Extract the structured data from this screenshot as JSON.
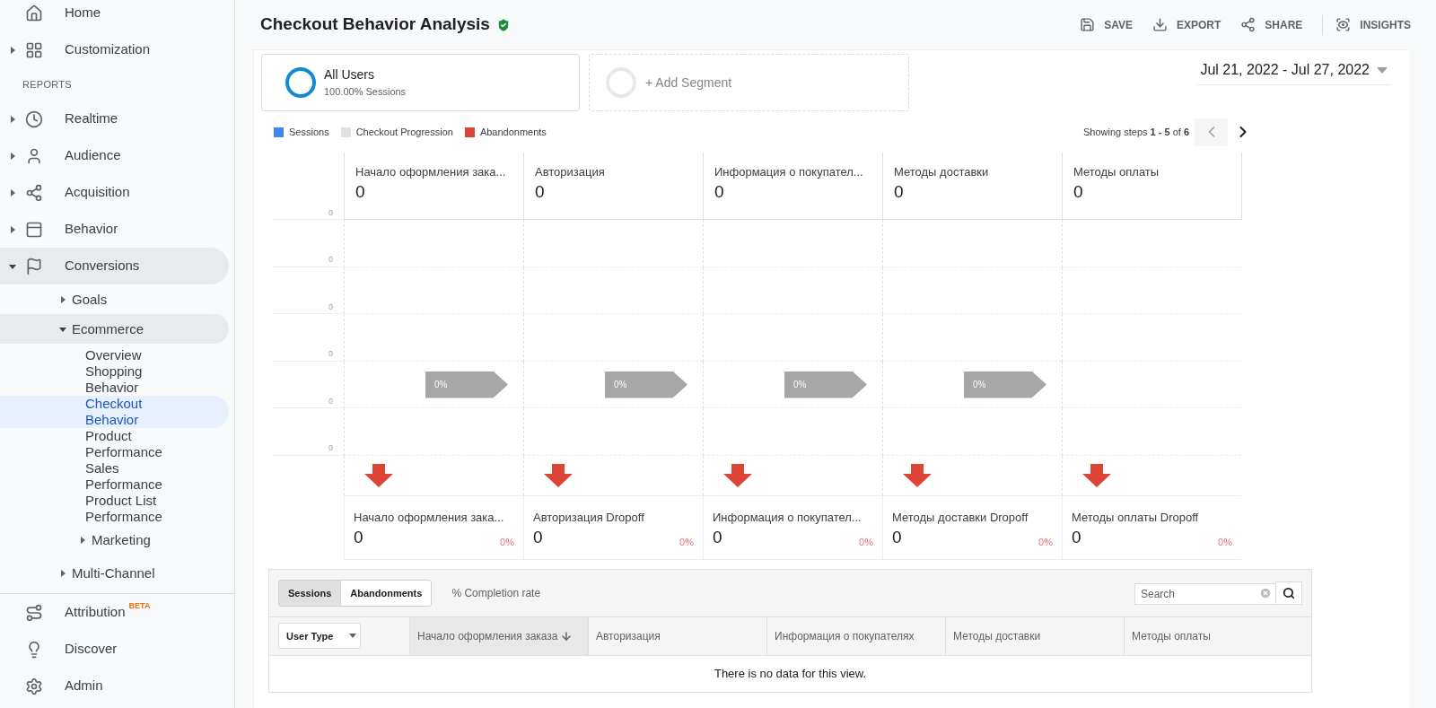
{
  "sidebar": {
    "top": [
      {
        "label": "Home",
        "selected": false
      },
      {
        "label": "Customization",
        "expanded": false,
        "selected": false
      }
    ],
    "reports_heading": "REPORTS",
    "reports": [
      {
        "label": "Realtime",
        "expanded": false,
        "selected": false
      },
      {
        "label": "Audience",
        "expanded": false,
        "selected": false
      },
      {
        "label": "Acquisition",
        "expanded": false,
        "selected": false
      },
      {
        "label": "Behavior",
        "expanded": false,
        "selected": false
      },
      {
        "label": "Conversions",
        "expanded": true,
        "selected": false,
        "children": [
          {
            "label": "Goals",
            "expanded": false,
            "selected": false
          },
          {
            "label": "Ecommerce",
            "expanded": true,
            "selected": false,
            "children": [
              {
                "label": "Overview",
                "selected": false
              },
              {
                "label": "Shopping Behavior",
                "selected": false
              },
              {
                "label": "Checkout Behavior",
                "selected": true
              },
              {
                "label": "Product Performance",
                "selected": false
              },
              {
                "label": "Sales Performance",
                "selected": false
              },
              {
                "label": "Product List Performance",
                "selected": false
              },
              {
                "label": "Marketing",
                "expanded": false,
                "selected": false
              }
            ]
          },
          {
            "label": "Multi-Channel",
            "expanded": false,
            "selected": false
          }
        ]
      }
    ],
    "bottom": [
      {
        "label": "Attribution",
        "badge": "BETA",
        "selected": false
      },
      {
        "label": "Discover",
        "selected": false
      },
      {
        "label": "Admin",
        "selected": false
      }
    ]
  },
  "header": {
    "title": "Checkout Behavior Analysis",
    "verified": true,
    "actions": [
      "SAVE",
      "EXPORT",
      "SHARE",
      "INSIGHTS"
    ]
  },
  "segments": [
    {
      "name": "All Users",
      "detail": "100.00% Sessions",
      "kind": "active"
    },
    {
      "name": "+ Add Segment",
      "kind": "add"
    }
  ],
  "date_range": "Jul 21, 2022 - Jul 27, 2022",
  "legend": [
    {
      "label": "Sessions",
      "color": "#4285f4"
    },
    {
      "label": "Checkout Progression",
      "color": "#e0e0e0"
    },
    {
      "label": "Abandonments",
      "color": "#db4437"
    }
  ],
  "pagination": {
    "text": "Showing steps **1 - 5** of **6**",
    "prev_disabled": true,
    "next_disabled": false
  },
  "funnel": {
    "axis_labels": [
      "0",
      "0",
      "0",
      "0",
      "0",
      "0"
    ],
    "steps": [
      {
        "label": "Начало оформления зака...",
        "value": "0",
        "progression": "0%",
        "dropoff_label": "Начало оформления зака...",
        "dropoff_value": "0",
        "dropoff_rate": "0%"
      },
      {
        "label": "Авторизация",
        "value": "0",
        "progression": "0%",
        "dropoff_label": "Авторизация Dropoff",
        "dropoff_value": "0",
        "dropoff_rate": "0%"
      },
      {
        "label": "Информация о покупател...",
        "value": "0",
        "progression": "0%",
        "dropoff_label": "Информация о покупател...",
        "dropoff_value": "0",
        "dropoff_rate": "0%"
      },
      {
        "label": "Методы доставки",
        "value": "0",
        "progression": "0%",
        "dropoff_label": "Методы доставки Dropoff",
        "dropoff_value": "0",
        "dropoff_rate": "0%"
      },
      {
        "label": "Методы оплаты",
        "value": "0",
        "dropoff_label": "Методы оплаты Dropoff",
        "dropoff_value": "0",
        "dropoff_rate": "0%"
      }
    ]
  },
  "table": {
    "toggles": [
      {
        "label": "Sessions",
        "selected": true
      },
      {
        "label": "Abandonments",
        "selected": false
      }
    ],
    "metric_label": "% Completion rate",
    "search": {
      "placeholder": "Search"
    },
    "dimension": "User Type",
    "columns": [
      {
        "label": "Начало оформления заказа",
        "sorted": true
      },
      {
        "label": "Авторизация",
        "sorted": false
      },
      {
        "label": "Информация о покупателях",
        "sorted": false
      },
      {
        "label": "Методы доставки",
        "sorted": false
      },
      {
        "label": "Методы оплаты",
        "sorted": false
      }
    ],
    "empty_message": "There is no data for this view."
  }
}
